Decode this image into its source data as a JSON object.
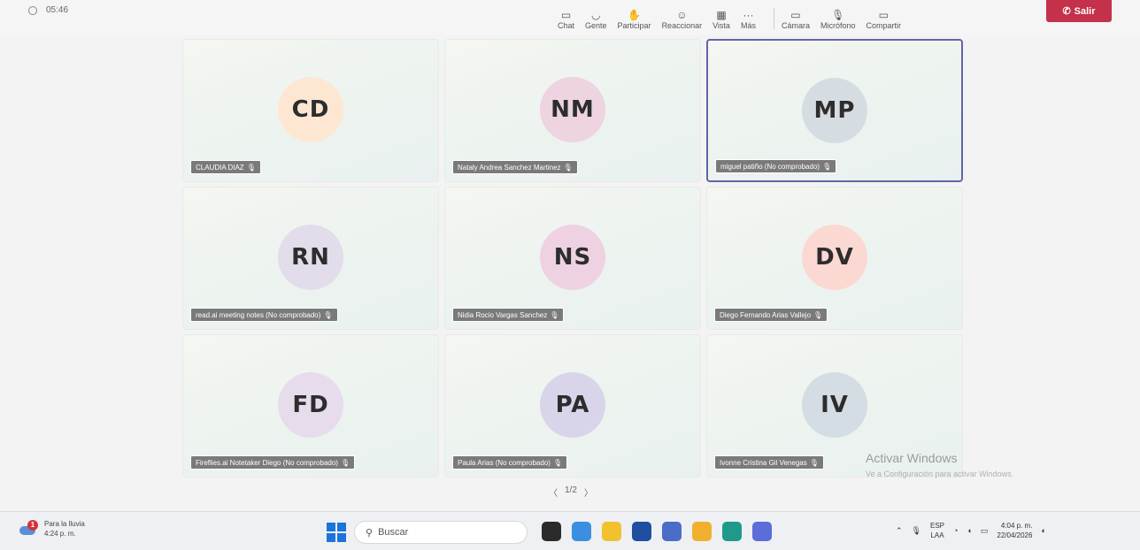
{
  "topbar": {
    "timer": "05:46",
    "tools": [
      {
        "label": "Chat",
        "icon": "chat-icon",
        "glyph": "▭"
      },
      {
        "label": "Gente",
        "icon": "people-icon",
        "glyph": "◡"
      },
      {
        "label": "Participar",
        "icon": "raise-hand-icon",
        "glyph": "✋"
      },
      {
        "label": "Reaccionar",
        "icon": "react-icon",
        "glyph": "☺"
      },
      {
        "label": "Vista",
        "icon": "view-icon",
        "glyph": "▦"
      },
      {
        "label": "Más",
        "icon": "more-icon",
        "glyph": "···"
      }
    ],
    "device_tools": [
      {
        "label": "Cámara",
        "icon": "camera-icon",
        "glyph": "▭"
      },
      {
        "label": "Micrófono",
        "icon": "microphone-icon",
        "glyph": "🎙"
      },
      {
        "label": "Compartir",
        "icon": "share-icon",
        "glyph": "▭"
      }
    ],
    "leave_label": "Salir",
    "leave_color": "#c4314b"
  },
  "participants": [
    {
      "initials": "CD",
      "name": "CLAUDIA DIAZ",
      "color": "#fde7d2"
    },
    {
      "initials": "NM",
      "name": "Nataly Andrea Sanchez Martinez",
      "color": "#eed3e0"
    },
    {
      "initials": "MP",
      "name": "miguel patiño (No comprobado)",
      "color": "#d6dde2",
      "active": true
    },
    {
      "initials": "RN",
      "name": "read.ai meeting notes (No comprobado)",
      "color": "#e2dceb"
    },
    {
      "initials": "NS",
      "name": "Nidia Rocio Vargas Sanchez",
      "color": "#efd2e1"
    },
    {
      "initials": "DV",
      "name": "Diego Fernando Arias Vallejo",
      "color": "#fbd9d2"
    },
    {
      "initials": "FD",
      "name": "Fireflies.ai Notetaker Diego (No comprobado)",
      "color": "#e6dcec"
    },
    {
      "initials": "PA",
      "name": "Paula Arias (No comprobado)",
      "color": "#d8d5ea"
    },
    {
      "initials": "IV",
      "name": "Ivonne Cristina Gil Venegas",
      "color": "#d3dde3"
    }
  ],
  "pager": {
    "prev": "〈",
    "text": "1/2",
    "next": "〉"
  },
  "watermark": {
    "title": "Activar Windows",
    "subtitle": "Ve a Configuración para activar Windows."
  },
  "taskbar": {
    "weather_badge": "1",
    "weather_line1": "Para la lluvia",
    "weather_line2": "4:24 p. m.",
    "search_placeholder": "Buscar",
    "apps": [
      {
        "icon": "terminal-icon",
        "color": "#2b2b2b"
      },
      {
        "icon": "copilot-icon",
        "color": "#3b8fe0"
      },
      {
        "icon": "file-explorer-icon",
        "color": "#f2c12e"
      },
      {
        "icon": "store-icon",
        "color": "#1e4fa0"
      },
      {
        "icon": "teams-icon",
        "color": "#4b6cc7"
      },
      {
        "icon": "chrome-icon",
        "color": "#f0b02e"
      },
      {
        "icon": "edge-icon",
        "color": "#1f9a8a"
      },
      {
        "icon": "chrome-canary-icon",
        "color": "#5b6dd9"
      }
    ],
    "lang_line1": "ESP",
    "lang_line2": "LAA",
    "time": "4:04 p. m.",
    "date": "22/04/2026"
  }
}
